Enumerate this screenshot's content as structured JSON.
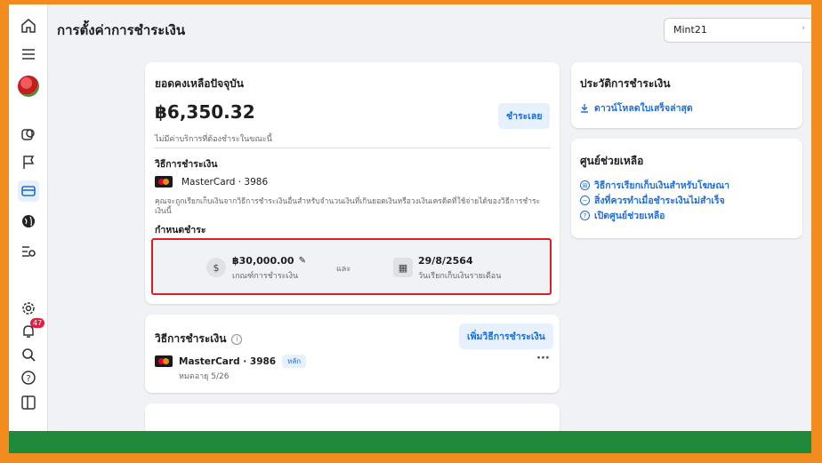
{
  "page": {
    "title": "การตั้งค่าการชำระเงิน",
    "account_selector": "Mint21"
  },
  "rail": {
    "icons": [
      "home-icon",
      "menu-icon",
      "avatar",
      "campaign-icon",
      "flag-icon",
      "billing-icon",
      "globe-icon",
      "settings-list-icon",
      "gear-icon",
      "notifications-icon",
      "search-icon",
      "help-icon",
      "panel-icon"
    ],
    "notification_count": "47"
  },
  "balance": {
    "title": "ยอดคงเหลือปัจจุบัน",
    "amount": "฿6,350.32",
    "pay_button": "ชำระเลย",
    "note": "ไม่มีค่าบริการที่ต้องชำระในขณะนี้",
    "method_heading": "วิธีการชำระเงิน",
    "method_card": "MasterCard · 3986",
    "method_desc": "คุณจะถูกเรียกเก็บเงินจากวิธีการชำระเงินอื่นสำหรับจำนวนเงินที่เกินยอดเงินหรือวงเงินเครดิตที่ใช้จ่ายได้ของวิธีการชำระเงินนี้",
    "schedule_heading": "กำหนดชำระ",
    "threshold_amount": "฿30,000.00",
    "threshold_label": "เกณฑ์การชำระเงิน",
    "and": "และ",
    "billing_date": "29/8/2564",
    "billing_date_label": "วันเรียกเก็บเงินรายเดือน"
  },
  "payment_methods": {
    "title": "วิธีการชำระเงิน",
    "add_button": "เพิ่มวิธีการชำระเงิน",
    "card_name": "MasterCard · 3986",
    "primary_tag": "หลัก",
    "expiry": "หมดอายุ 5/26",
    "more": "···"
  },
  "history": {
    "title": "ประวัติการชำระเงิน",
    "download_link": "ดาวน์โหลดใบเสร็จล่าสุด"
  },
  "help_center": {
    "title": "ศูนย์ช่วยเหลือ",
    "links": [
      "วิธีการเรียกเก็บเงินสำหรับโฆษณา",
      "สิ่งที่ควรทำเมื่อชำระเงินไม่สำเร็จ",
      "เปิดศูนย์ช่วยเหลือ"
    ]
  },
  "colors": {
    "accent": "#216fdb",
    "highlight_border": "#e21b23",
    "outer_frame": "#f28c1f",
    "bottom_bar": "#1f8a3a"
  }
}
